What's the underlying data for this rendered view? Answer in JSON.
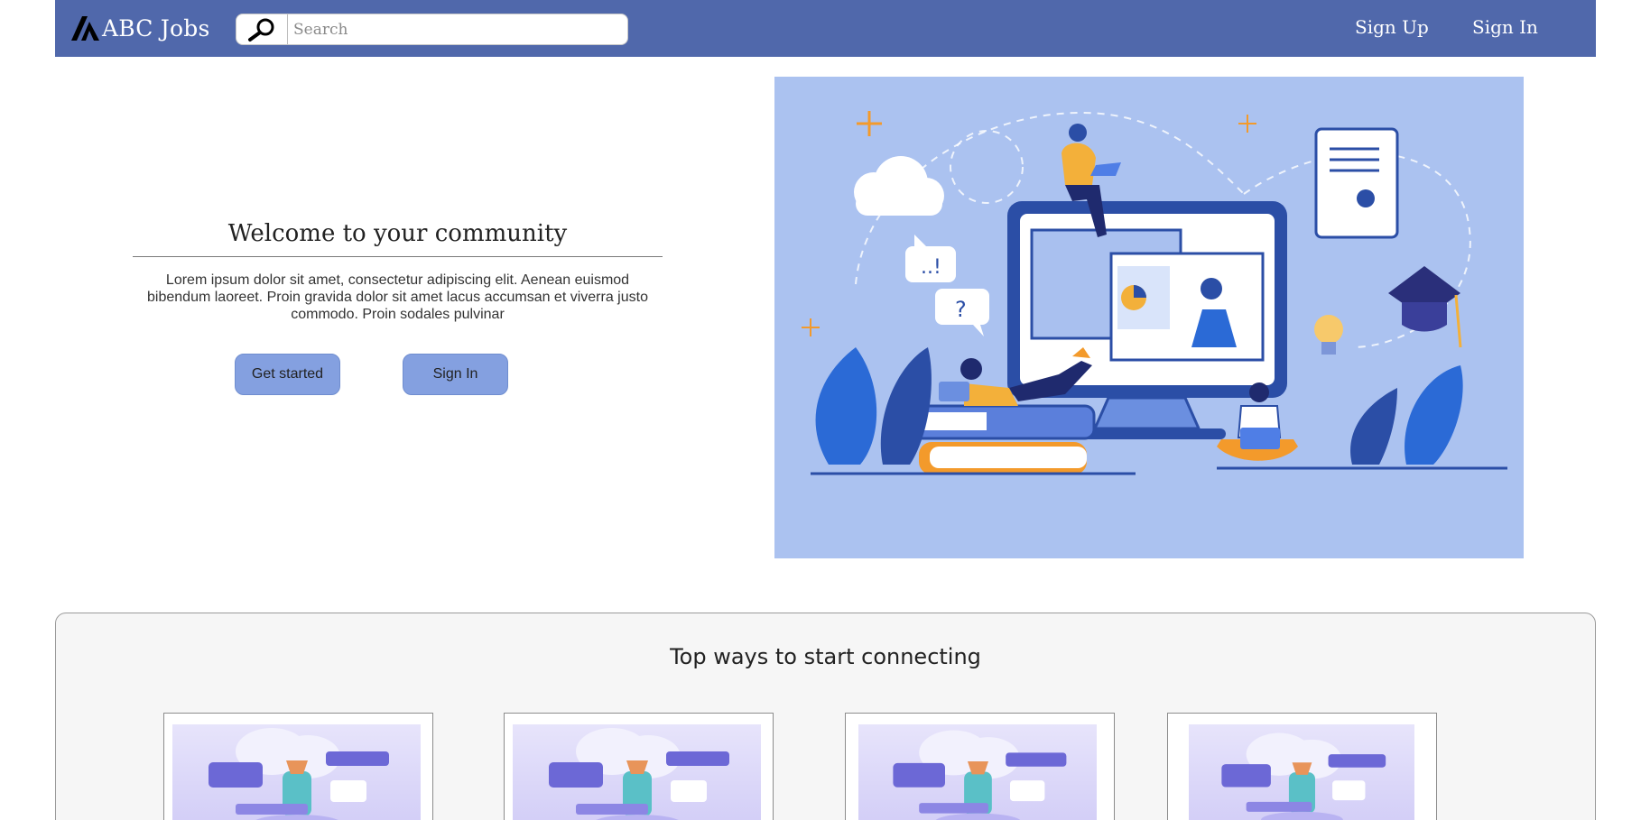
{
  "header": {
    "brand_name": "ABC Jobs",
    "search_placeholder": "Search",
    "nav": {
      "signup": "Sign Up",
      "signin": "Sign In"
    }
  },
  "hero": {
    "title": "Welcome to your community",
    "description": "Lorem ipsum dolor sit amet, consectetur adipiscing elit. Aenean euismod bibendum laoreet. Proin gravida dolor sit amet lacus accumsan et viverra justo commodo. Proin sodales pulvinar",
    "buttons": {
      "get_started": "Get started",
      "sign_in": "Sign In"
    },
    "bubble_exclaim": "..!",
    "bubble_question": "?"
  },
  "connect": {
    "title": "Top ways to start connecting",
    "cards": [
      {
        "image": "connect-illustration"
      },
      {
        "image": "connect-illustration"
      },
      {
        "image": "connect-illustration"
      },
      {
        "image": "connect-illustration"
      }
    ]
  },
  "colors": {
    "navbar": "#5068ab",
    "button": "#84a0e0",
    "illustration_bg": "#abc2f0"
  },
  "icons": {
    "brand": "abc-logo-icon",
    "search": "magnifier-icon"
  }
}
